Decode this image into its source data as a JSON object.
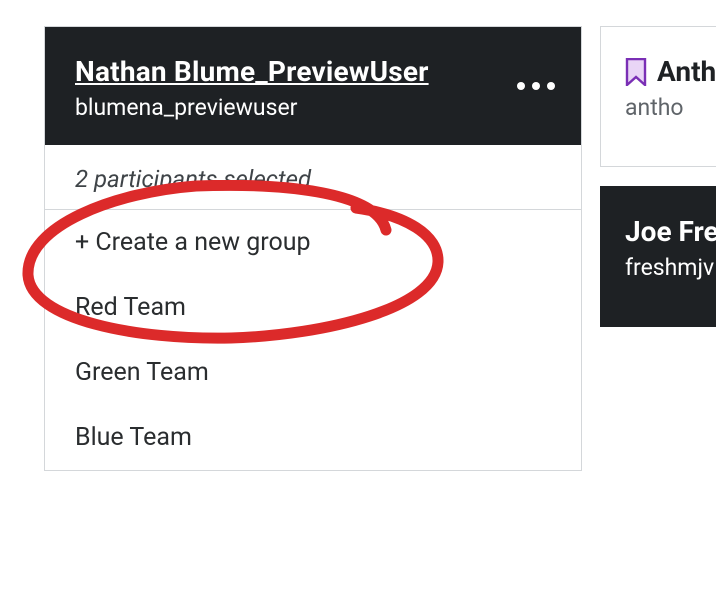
{
  "primaryCard": {
    "title": "Nathan Blume_PreviewUser",
    "subtitle": "blumena_previewuser"
  },
  "dropdown": {
    "status": "2 participants selected",
    "createLabel": "+ Create a new group",
    "groups": [
      "Red Team",
      "Green Team",
      "Blue Team"
    ]
  },
  "sideCards": {
    "light": {
      "titleFrag": "Anth",
      "subtitleFrag": "antho"
    },
    "dark": {
      "titleFrag": "Joe Fre",
      "subtitleFrag": "freshmjv"
    }
  },
  "colors": {
    "annotation": "#dc2a2a",
    "bookmarkStroke": "#7a2fb5",
    "bookmarkFill": "#e9d5f6"
  }
}
